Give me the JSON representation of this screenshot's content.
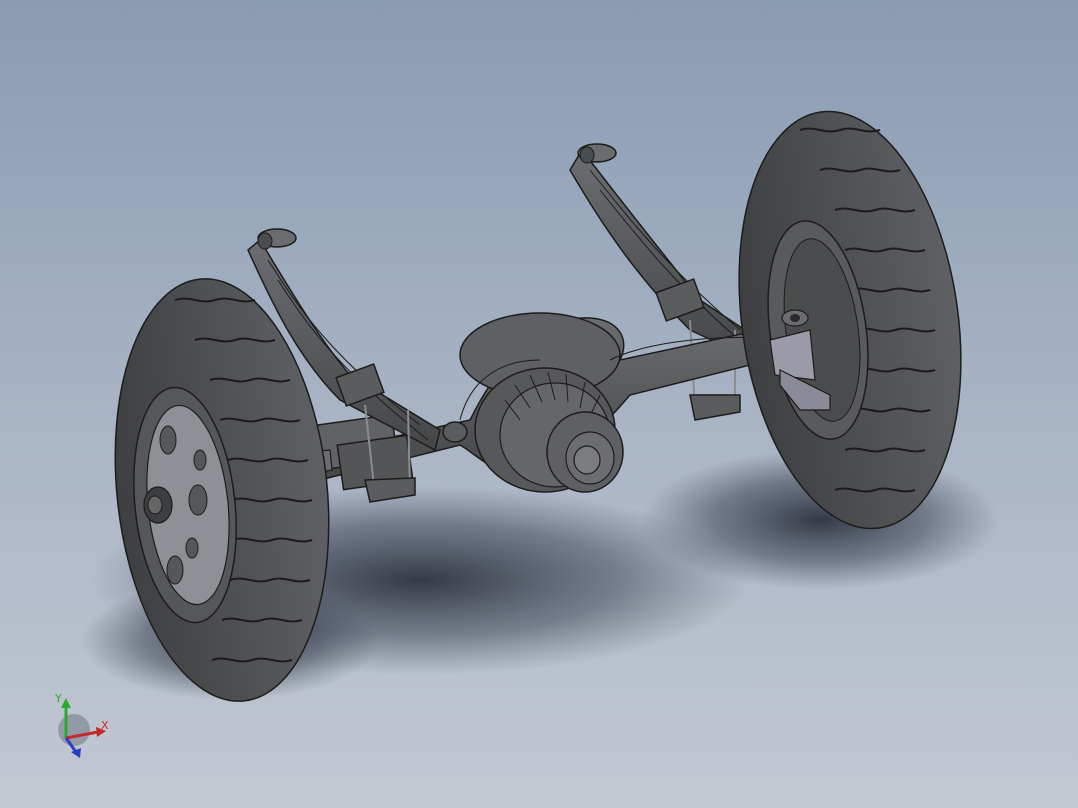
{
  "viewport": {
    "background_top": "#8a9bb2",
    "background_bottom": "#c3c9d3"
  },
  "model": {
    "part_color": "#5a5c5e",
    "edge_color": "#1c1c1c",
    "tire_color": "#4d4f51",
    "rim_color": "#8d9094",
    "bracket_color": "#9a9aa8"
  },
  "triad": {
    "x_label": "X",
    "y_label": "Y",
    "x_color": "#c42a2a",
    "y_color": "#2ea82e",
    "z_color": "#2a3ec4"
  }
}
